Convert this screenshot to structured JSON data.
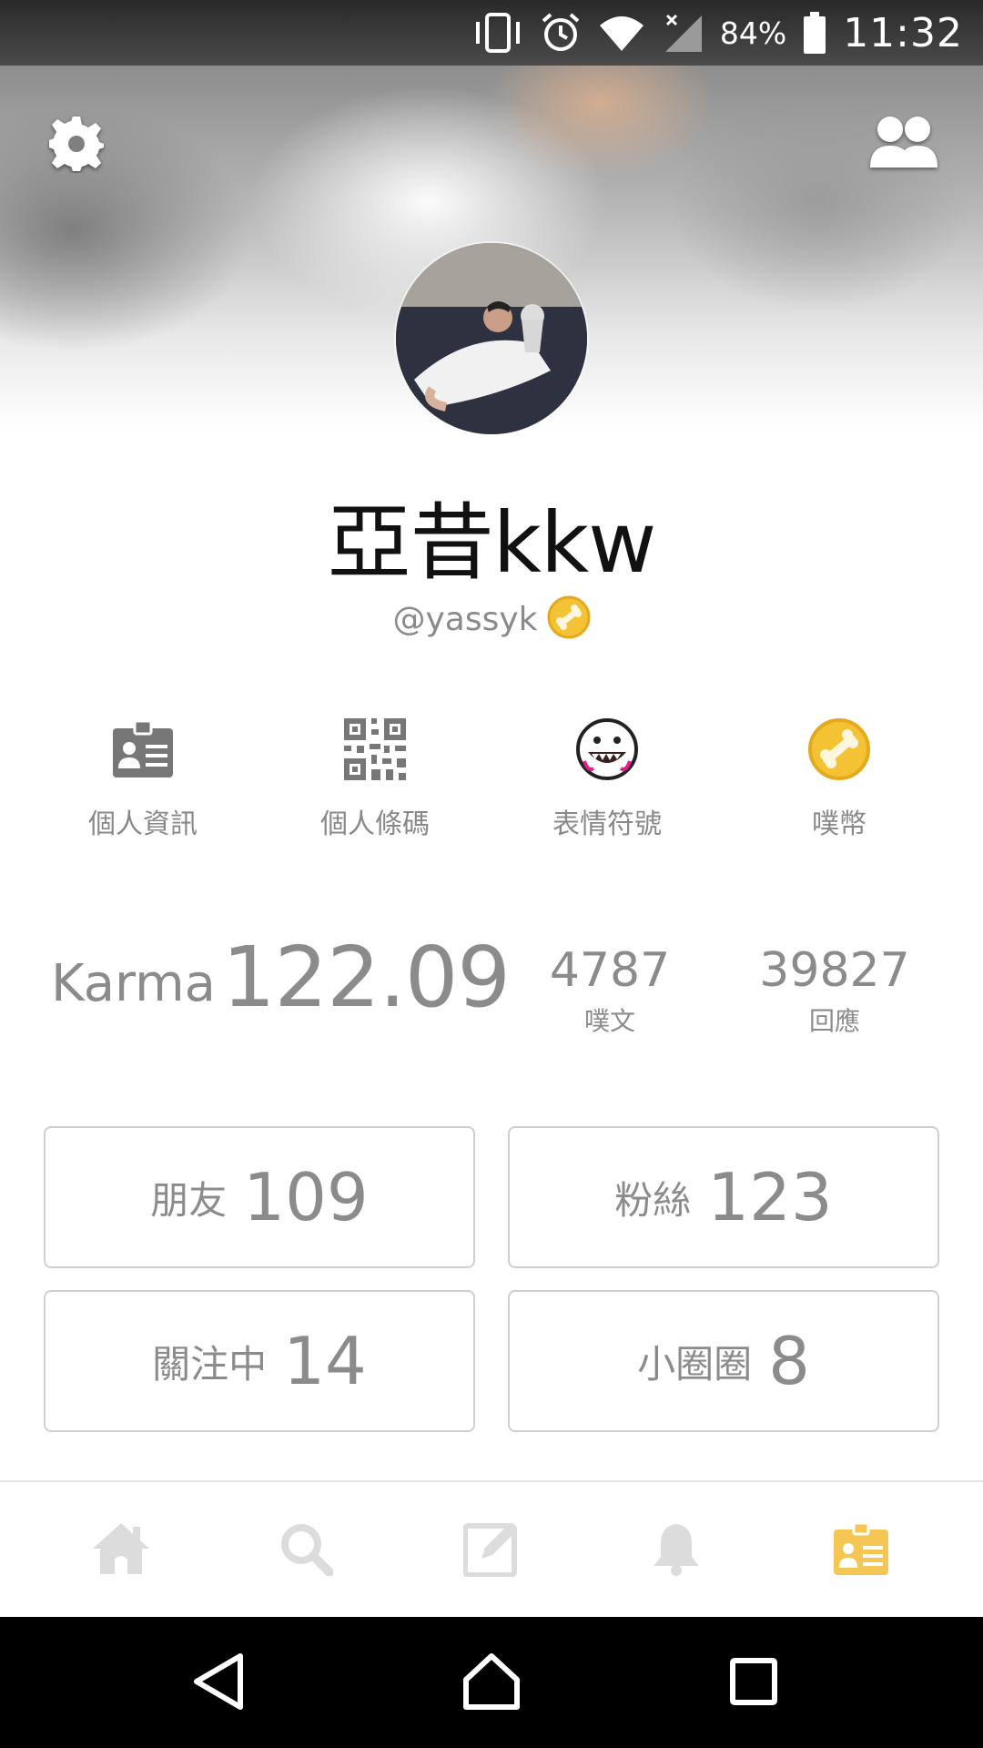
{
  "status_bar": {
    "battery_percent": "84%",
    "time": "11:32",
    "icons": [
      "vibrate-icon",
      "alarm-icon",
      "wifi-icon",
      "no-signal-icon",
      "battery-icon"
    ]
  },
  "header": {
    "settings_icon": "gear-icon",
    "friends_icon": "people-icon"
  },
  "profile": {
    "display_name": "亞昔kkw",
    "handle": "@yassyk",
    "badge_icon": "bone-coin-icon"
  },
  "actions": [
    {
      "label": "個人資訊",
      "icon": "id-card-icon"
    },
    {
      "label": "個人條碼",
      "icon": "qr-code-icon"
    },
    {
      "label": "表情符號",
      "icon": "emoji-icon"
    },
    {
      "label": "噗幣",
      "icon": "bone-coin-icon"
    }
  ],
  "stats": {
    "karma_label": "Karma",
    "karma_value": "122.09",
    "plurks_count": "4787",
    "plurks_label": "噗文",
    "responses_count": "39827",
    "responses_label": "回應"
  },
  "counts": [
    {
      "label": "朋友",
      "value": "109"
    },
    {
      "label": "粉絲",
      "value": "123"
    },
    {
      "label": "關注中",
      "value": "14"
    },
    {
      "label": "小圈圈",
      "value": "8"
    }
  ],
  "tabs": [
    {
      "icon": "home-icon",
      "active": false
    },
    {
      "icon": "search-icon",
      "active": false
    },
    {
      "icon": "compose-icon",
      "active": false
    },
    {
      "icon": "bell-icon",
      "active": false
    },
    {
      "icon": "profile-card-icon",
      "active": true
    }
  ],
  "colors": {
    "active_tab": "#f5c653",
    "inactive_tab": "#dcdcdc",
    "text_gray": "#8b8b8b"
  }
}
